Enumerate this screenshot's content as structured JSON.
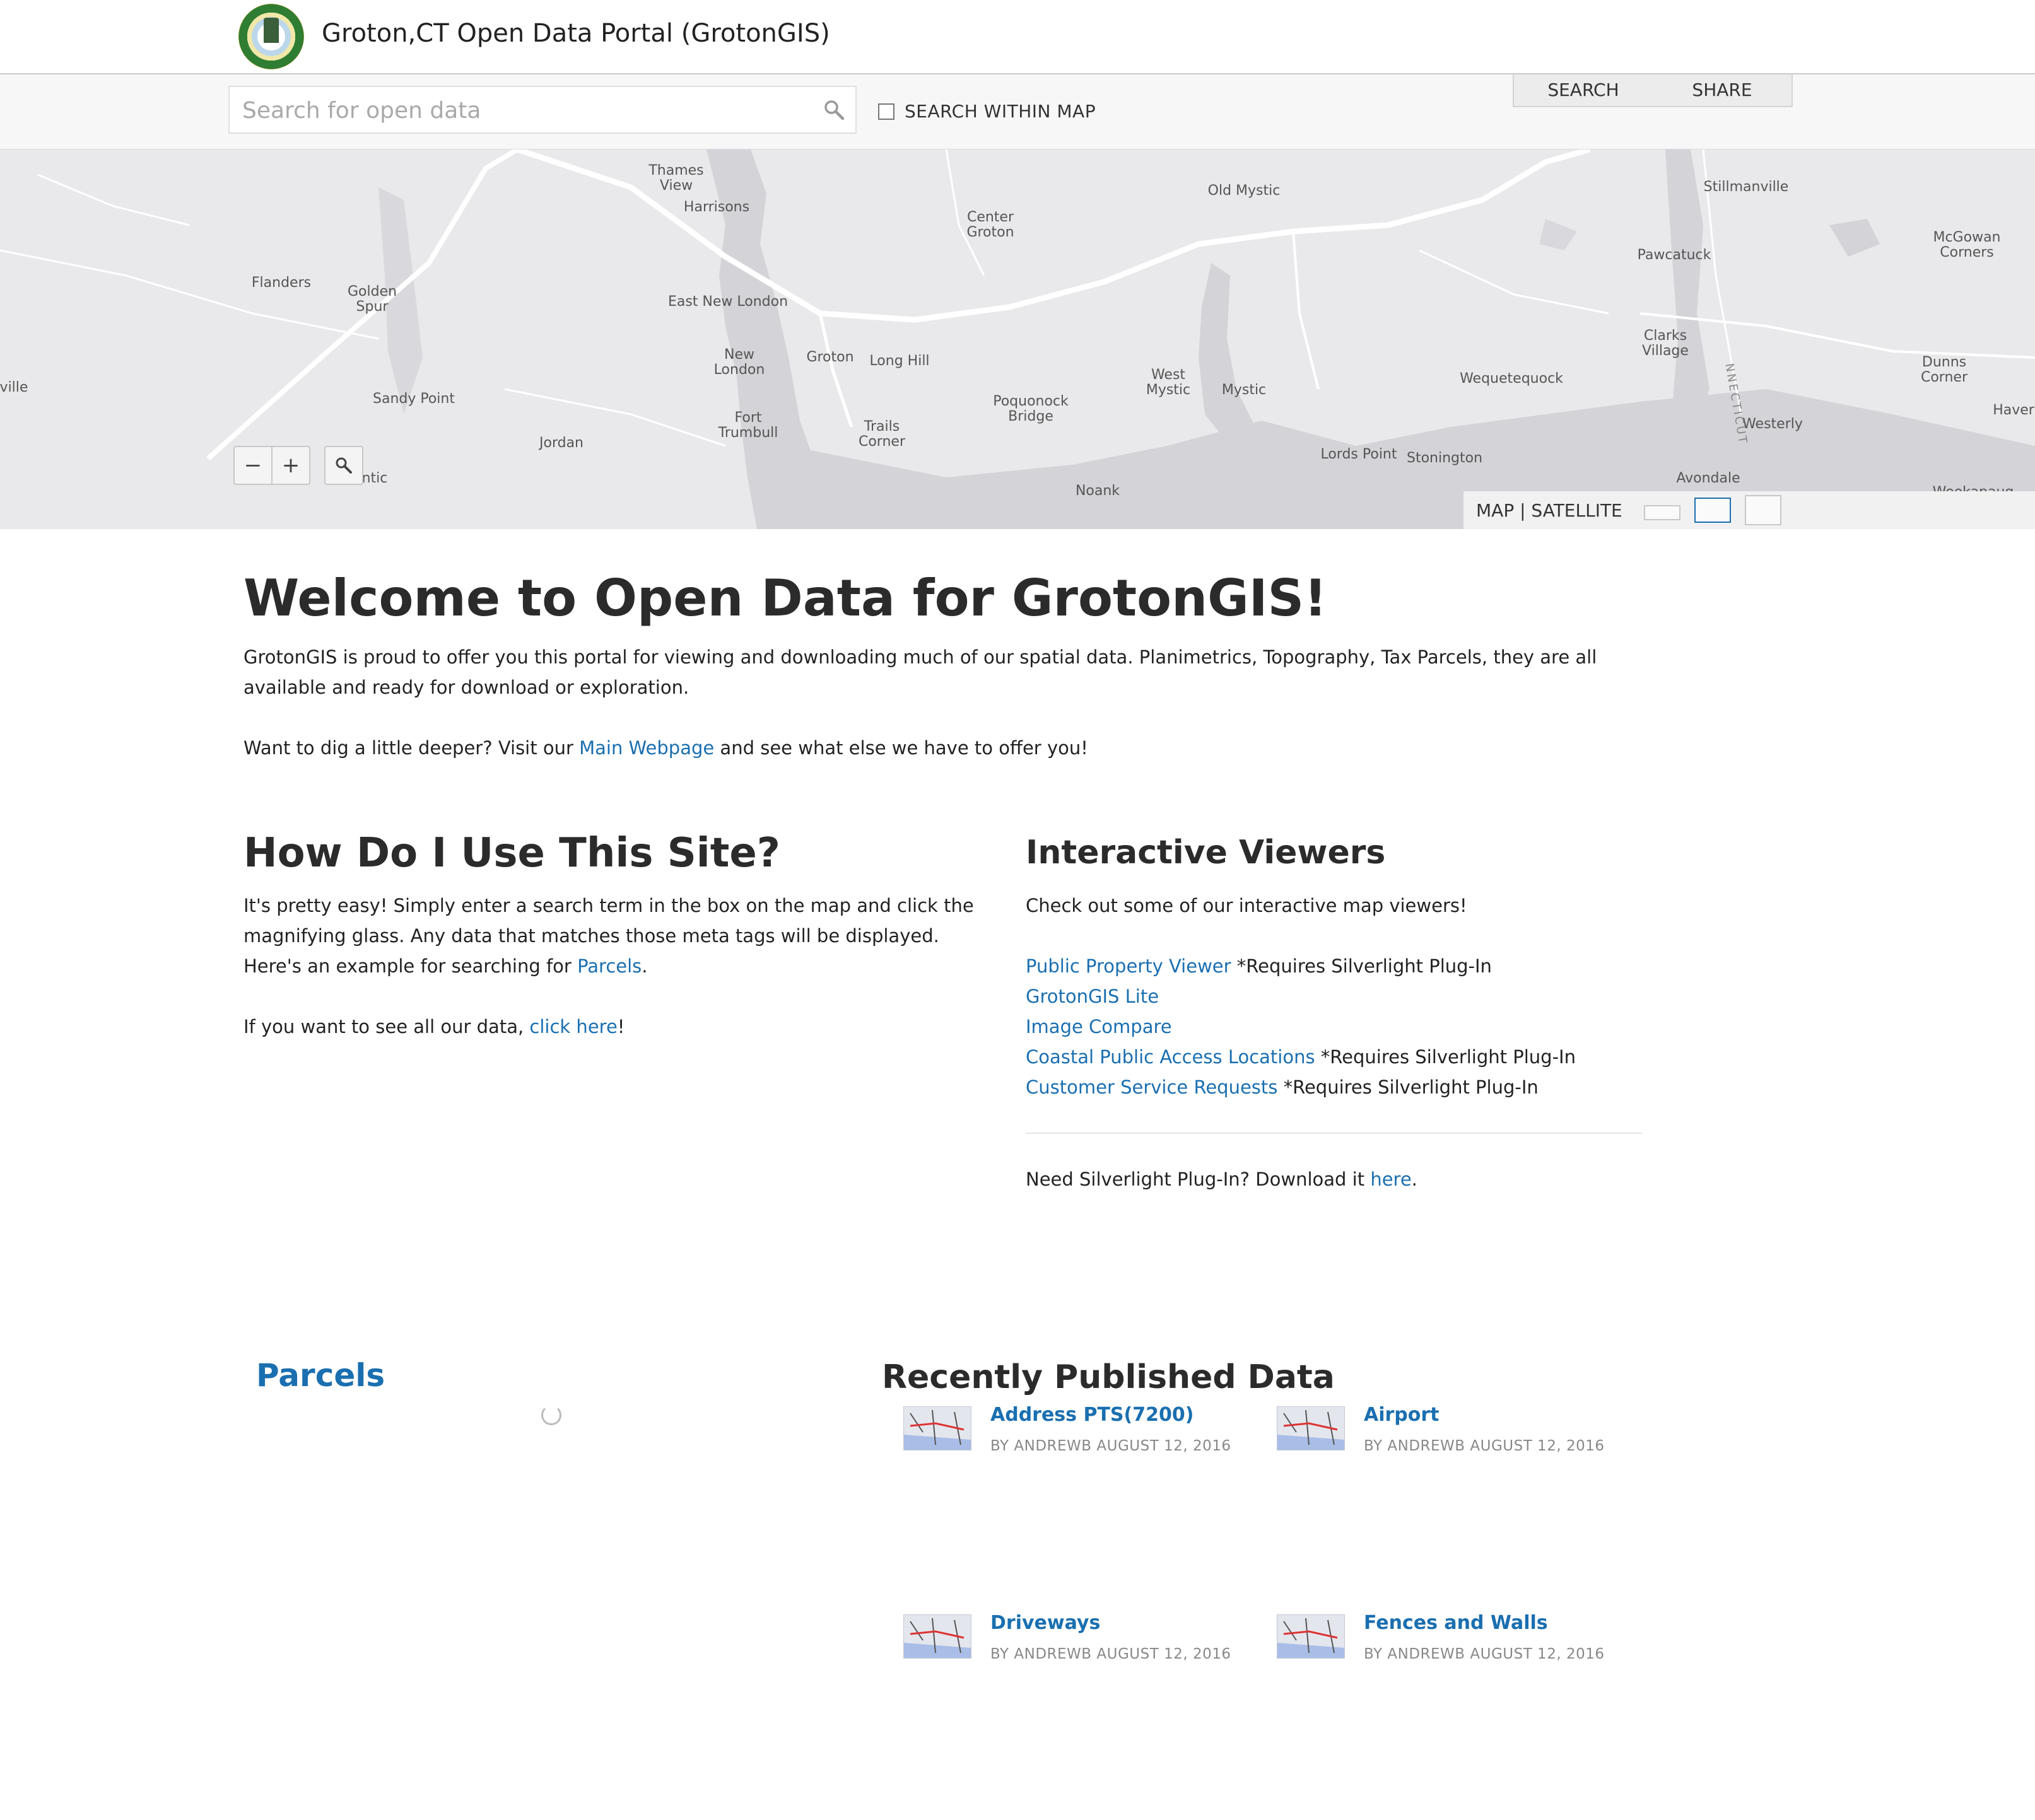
{
  "header": {
    "title": "Groton,CT Open Data Portal (GrotonGIS)"
  },
  "search": {
    "placeholder": "Search for open data",
    "within_map_label": "SEARCH WITHIN MAP",
    "tabs": [
      "SEARCH",
      "SHARE"
    ]
  },
  "map": {
    "labels": [
      "Thames View",
      "Harrisons",
      "Old Mystic",
      "Stillmanville",
      "Center Groton",
      "McGowan Corners",
      "Pawcatuck",
      "Flanders",
      "Golden Spur",
      "East New London",
      "Clarks Village",
      "New London",
      "Groton",
      "Long Hill",
      "ville",
      "Sandy Point",
      "Poquonock Bridge",
      "West Mystic",
      "Mystic",
      "Wequetequock",
      "Dunns Corner",
      "Haver",
      "Westerly",
      "Fort Trumbull",
      "Trails Corner",
      "Jordan",
      "Lords Point",
      "Stonington",
      "Avondale",
      "Noank",
      "Weekapaug",
      "ntic",
      "NNECTICUT"
    ],
    "zoom_out": "−",
    "zoom_in": "+",
    "basemap_label": "MAP | SATELLITE"
  },
  "welcome": {
    "title": "Welcome to Open Data for GrotonGIS!",
    "intro": "GrotonGIS is proud to offer you this portal for viewing and downloading much of our spatial data. Planimetrics, Topography, Tax Parcels, they are all available and ready for download or exploration.",
    "deeper_before": "Want to dig a little deeper? Visit our ",
    "deeper_link": "Main Webpage",
    "deeper_after": " and see what else we have to offer you!"
  },
  "howto": {
    "title": "How Do I Use This Site?",
    "text_before": "It's pretty easy! Simply enter a search term in the box on the map and click the magnifying glass. Any data that matches those meta tags will be displayed. Here's an example for searching for ",
    "text_link": "Parcels",
    "text_after": ".",
    "all_before": "If you want to see all our data, ",
    "all_link": "click here",
    "all_after": "!"
  },
  "viewers": {
    "title": "Interactive Viewers",
    "intro": "Check out some of our interactive map viewers!",
    "items": [
      {
        "label": "Public Property Viewer",
        "note": " *Requires Silverlight Plug-In"
      },
      {
        "label": "GrotonGIS Lite",
        "note": ""
      },
      {
        "label": "Image Compare",
        "note": ""
      },
      {
        "label": "Coastal Public Access Locations",
        "note": " *Requires Silverlight Plug-In"
      },
      {
        "label": "Customer Service Requests",
        "note": " *Requires Silverlight Plug-In"
      }
    ],
    "silverlight_before": "Need Silverlight Plug-In? Download it ",
    "silverlight_link": "here",
    "silverlight_after": "."
  },
  "parcels": {
    "title": "Parcels"
  },
  "recent": {
    "title": "Recently Published Data",
    "items": [
      {
        "title": "Address PTS(7200)",
        "meta": "BY ANDREWB AUGUST 12, 2016"
      },
      {
        "title": "Airport",
        "meta": "BY ANDREWB AUGUST 12, 2016"
      },
      {
        "title": "Driveways",
        "meta": "BY ANDREWB AUGUST 12, 2016"
      },
      {
        "title": "Fences and Walls",
        "meta": "BY ANDREWB AUGUST 12, 2016"
      }
    ]
  }
}
